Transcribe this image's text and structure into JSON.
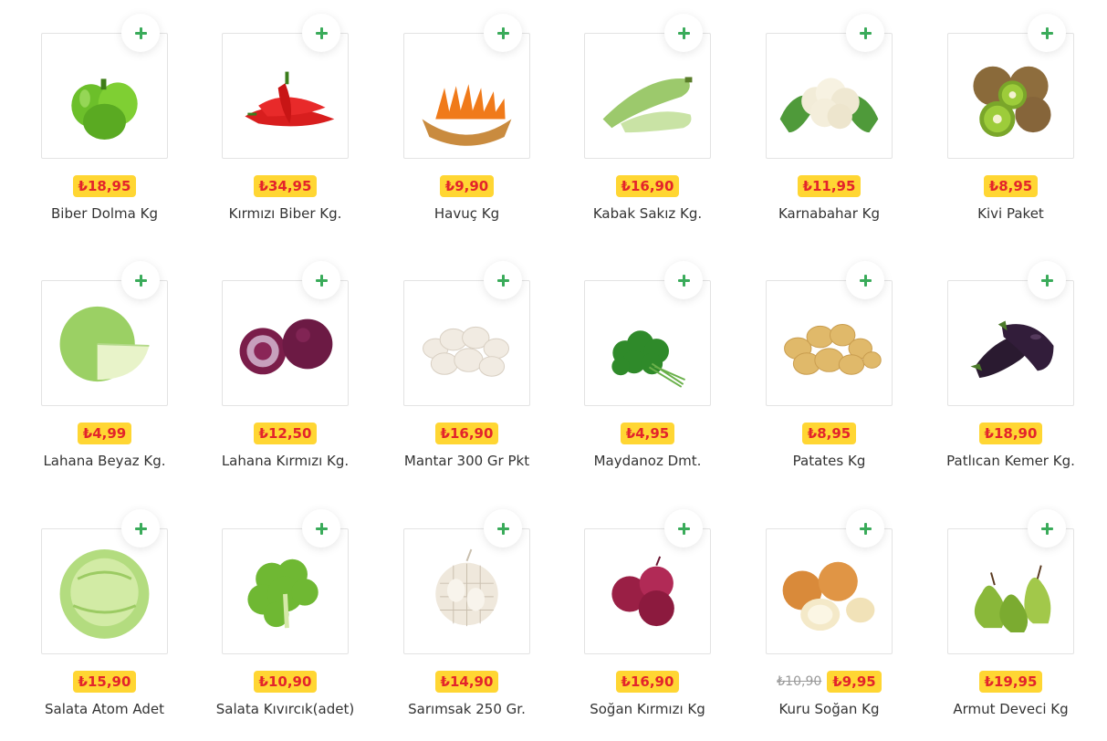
{
  "currency": "₺",
  "products": [
    {
      "name": "Biber Dolma Kg",
      "price": "₺18,95",
      "old_price": "",
      "icon": "green-pepper"
    },
    {
      "name": "Kırmızı Biber Kg.",
      "price": "₺34,95",
      "old_price": "",
      "icon": "red-pepper"
    },
    {
      "name": "Havuç Kg",
      "price": "₺9,90",
      "old_price": "",
      "icon": "carrot"
    },
    {
      "name": "Kabak Sakız Kg.",
      "price": "₺16,90",
      "old_price": "",
      "icon": "zucchini"
    },
    {
      "name": "Karnabahar Kg",
      "price": "₺11,95",
      "old_price": "",
      "icon": "cauliflower"
    },
    {
      "name": "Kivi Paket",
      "price": "₺8,95",
      "old_price": "",
      "icon": "kiwi"
    },
    {
      "name": "Lahana Beyaz Kg.",
      "price": "₺4,99",
      "old_price": "",
      "icon": "white-cabbage"
    },
    {
      "name": "Lahana Kırmızı Kg.",
      "price": "₺12,50",
      "old_price": "",
      "icon": "red-cabbage"
    },
    {
      "name": "Mantar 300 Gr Pkt",
      "price": "₺16,90",
      "old_price": "",
      "icon": "mushroom"
    },
    {
      "name": "Maydanoz Dmt.",
      "price": "₺4,95",
      "old_price": "",
      "icon": "parsley"
    },
    {
      "name": "Patates Kg",
      "price": "₺8,95",
      "old_price": "",
      "icon": "potato"
    },
    {
      "name": "Patlıcan Kemer Kg.",
      "price": "₺18,90",
      "old_price": "",
      "icon": "eggplant"
    },
    {
      "name": "Salata Atom Adet",
      "price": "₺15,90",
      "old_price": "",
      "icon": "iceberg-lettuce"
    },
    {
      "name": "Salata Kıvırcık(adet)",
      "price": "₺10,90",
      "old_price": "",
      "icon": "curly-lettuce"
    },
    {
      "name": "Sarımsak 250 Gr.",
      "price": "₺14,90",
      "old_price": "",
      "icon": "garlic"
    },
    {
      "name": "Soğan Kırmızı Kg",
      "price": "₺16,90",
      "old_price": "",
      "icon": "red-onion"
    },
    {
      "name": "Kuru Soğan Kg",
      "price": "₺9,95",
      "old_price": "₺10,90",
      "icon": "onion"
    },
    {
      "name": "Armut Deveci Kg",
      "price": "₺19,95",
      "old_price": "",
      "icon": "pear"
    }
  ],
  "colors": {
    "price_bg": "#ffd633",
    "price_text": "#e3242b",
    "add_icon": "#3aab5a",
    "border": "#e3e3e3"
  }
}
